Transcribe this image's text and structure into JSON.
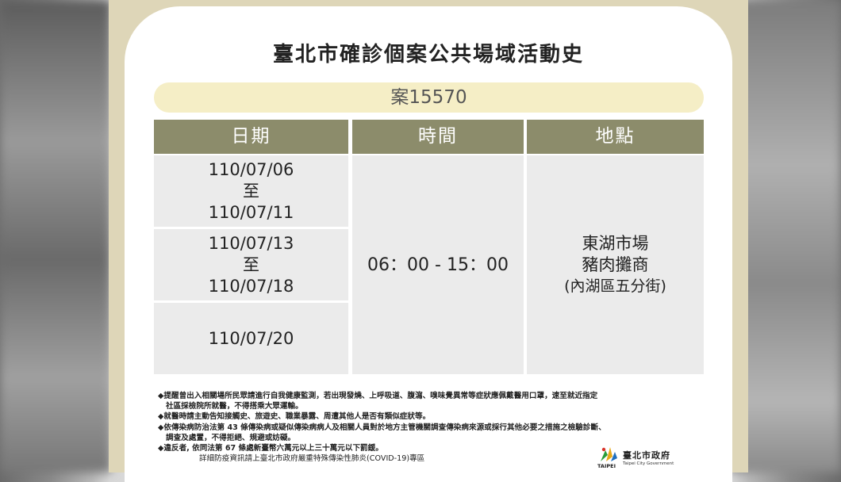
{
  "title": "臺北市確診個案公共場域活動史",
  "case_id": "案15570",
  "table": {
    "headers": [
      "日期",
      "時間",
      "地點"
    ],
    "date_rows": [
      {
        "start": "110/07/06",
        "sep": "至",
        "end": "110/07/11"
      },
      {
        "start": "110/07/13",
        "sep": "至",
        "end": "110/07/18"
      },
      {
        "single": "110/07/20"
      }
    ],
    "time": "06：00 - 15：00",
    "place": {
      "line1": "東湖市場",
      "line2": "豬肉攤商",
      "line3": "(內湖區五分街)"
    }
  },
  "notes": [
    "◆提醒曾出入相關場所民眾請進行自我健康監測，若出現發燒、上呼吸道、腹瀉、嗅味覺異常等症狀應佩戴醫用口罩，速至就近指定",
    "社區採檢院所就醫，不得搭乘大眾運輸。",
    "◆就醫時請主動告知接觸史、旅遊史、職業暴露、周遭其他人是否有類似症狀等。",
    "◆依傳染病防治法第 43 條傳染病或疑似傳染病病人及相關人員對於地方主管機關調查傳染病來源或採行其他必要之措施之檢驗診斷、",
    "調查及處置，不得拒絕、規避或妨礙。",
    "◆違反者, 依同法第 67 條處新臺幣六萬元以上三十萬元以下罰鍰。",
    "詳細防疫資訊請上臺北市政府嚴重特殊傳染性肺炎(COVID-19)專區"
  ],
  "logo": {
    "cn": "臺北市政府",
    "en": "Taipei City Government",
    "mark_text": "TAIPEI"
  },
  "colors": {
    "header_bg": "#8c8c6b",
    "pill_bg": "#f5eec6",
    "frame": "#ded6b8",
    "cell_bg": "#ebebeb"
  }
}
